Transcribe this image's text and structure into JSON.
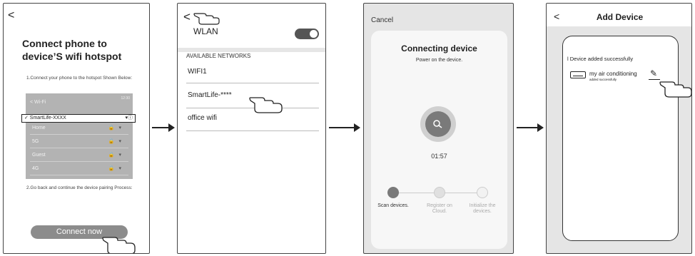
{
  "screens": {
    "hotspot": {
      "back": "<",
      "title": "Connect phone to device’S wifi hotspot",
      "step1": "1.Connect your phone to the hotspot Shown Below:",
      "wifi_header": "< Wi-Fi",
      "status_time": "12:30",
      "selected_network": "✓ SmartLife-XXXX",
      "networks": [
        "Home",
        "5G",
        "Guest",
        "4G"
      ],
      "step2": "2.Go back and  continue the device pairing Process:",
      "button": "Connect now"
    },
    "wlan": {
      "back": "<",
      "title": "WLAN",
      "section": "AVAILABLE NETWORKS",
      "networks": [
        "WIFI1",
        "SmartLife-****",
        "office wifi"
      ]
    },
    "connecting": {
      "cancel": "Cancel",
      "title": "Connecting device",
      "subtitle": "Power on the device.",
      "timer": "01:57",
      "steps": [
        {
          "label": "Scan devices."
        },
        {
          "label": "Register on Cloud."
        },
        {
          "label": "Initialize the devices."
        }
      ]
    },
    "added": {
      "back": "<",
      "title": "Add Device",
      "success": "l Device added successfully",
      "device_name": "my air conditioning",
      "device_status": "added successfully"
    }
  },
  "colors": {
    "accent_gray": "#7a7a7a",
    "button_gray": "#8c8c8c",
    "bg_gray": "#e5e5e5"
  }
}
